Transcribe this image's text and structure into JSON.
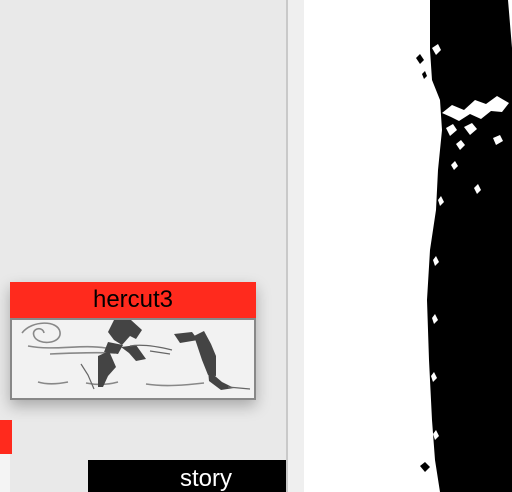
{
  "thumbnails": [
    {
      "title": "hercut3",
      "title_color": "#ff2a1d"
    }
  ],
  "tags": {
    "story": "story"
  },
  "colors": {
    "accent": "#ff2a1d",
    "panel_bg": "#e9e9e9",
    "preview_bg": "#ffffff",
    "preview_fg": "#000000"
  }
}
